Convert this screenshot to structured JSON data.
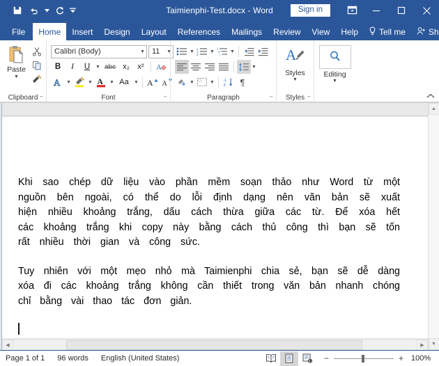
{
  "titlebar": {
    "document_title": "Taimienphi-Test.docx  -  Word",
    "quick_access": [
      {
        "name": "save",
        "label": "Save"
      },
      {
        "name": "undo",
        "label": "Undo"
      },
      {
        "name": "redo",
        "label": "Redo"
      },
      {
        "name": "customize-quick-access-toolbar",
        "label": "Customize Quick Access Toolbar"
      }
    ],
    "sign_in": "Sign in",
    "window_buttons": [
      {
        "name": "ribbon-display-options",
        "label": "Ribbon Display Options"
      },
      {
        "name": "minimize",
        "label": "Minimize"
      },
      {
        "name": "maximize",
        "label": "Maximize"
      },
      {
        "name": "close",
        "label": "Close"
      }
    ]
  },
  "tabs": [
    {
      "label": "File",
      "active": false
    },
    {
      "label": "Home",
      "active": true
    },
    {
      "label": "Insert",
      "active": false
    },
    {
      "label": "Design",
      "active": false
    },
    {
      "label": "Layout",
      "active": false
    },
    {
      "label": "References",
      "active": false
    },
    {
      "label": "Mailings",
      "active": false
    },
    {
      "label": "Review",
      "active": false
    },
    {
      "label": "View",
      "active": false
    },
    {
      "label": "Help",
      "active": false
    }
  ],
  "tab_right": {
    "tell_me": "Tell me",
    "share": "Share"
  },
  "ribbon": {
    "clipboard": {
      "group_label": "Clipboard",
      "paste_label": "Paste",
      "buttons": [
        {
          "name": "cut",
          "label": "Cut"
        },
        {
          "name": "copy",
          "label": "Copy"
        },
        {
          "name": "format-painter",
          "label": "Format Painter"
        }
      ]
    },
    "font": {
      "group_label": "Font",
      "font_name": "Calibri (Body)",
      "font_size": "11",
      "buttons": [
        {
          "name": "bold",
          "label": "B"
        },
        {
          "name": "italic",
          "label": "I"
        },
        {
          "name": "underline",
          "label": "U"
        },
        {
          "name": "strikethrough",
          "label": "abc"
        },
        {
          "name": "subscript",
          "label": "x₂"
        },
        {
          "name": "superscript",
          "label": "x²"
        },
        {
          "name": "clear-formatting",
          "label": "Clear All Formatting"
        },
        {
          "name": "text-effects",
          "label": "Text Effects and Typography"
        },
        {
          "name": "text-highlight-color",
          "label": "Text Highlight Color"
        },
        {
          "name": "font-color",
          "label": "Font Color"
        },
        {
          "name": "change-case",
          "label": "Aa"
        },
        {
          "name": "grow-font",
          "label": "A"
        },
        {
          "name": "shrink-font",
          "label": "A"
        }
      ]
    },
    "paragraph": {
      "group_label": "Paragraph",
      "buttons": [
        {
          "name": "bullets",
          "label": "Bullets"
        },
        {
          "name": "numbering",
          "label": "Numbering"
        },
        {
          "name": "multilevel-list",
          "label": "Multilevel List"
        },
        {
          "name": "decrease-indent",
          "label": "Decrease Indent"
        },
        {
          "name": "increase-indent",
          "label": "Increase Indent"
        },
        {
          "name": "align-left",
          "label": "Align Left"
        },
        {
          "name": "align-center",
          "label": "Center"
        },
        {
          "name": "align-right",
          "label": "Align Right"
        },
        {
          "name": "justify",
          "label": "Justify"
        },
        {
          "name": "line-spacing",
          "label": "Line and Paragraph Spacing"
        },
        {
          "name": "shading",
          "label": "Shading"
        },
        {
          "name": "borders",
          "label": "Borders"
        },
        {
          "name": "sort",
          "label": "Sort"
        },
        {
          "name": "show-formatting-marks",
          "label": "¶"
        }
      ]
    },
    "styles": {
      "group_label": "Styles",
      "button_label": "Styles"
    },
    "editing": {
      "group_label": "Editing",
      "button_label": "Editing"
    },
    "collapse_label": "Collapse the Ribbon"
  },
  "document": {
    "paragraphs": [
      "Khi sao chép dữ liệu vào phần mềm soạn thảo như Word từ một nguồn bên ngoài, có thể do lỗi định dạng nên văn bản sẽ xuất hiện nhiều khoảng trắng, dấu cách thừa giữa các từ. Để xóa hết các khoảng trắng khi copy này bằng cách thủ công thì bạn sẽ tốn rất nhiều thời gian và công sức.",
      "Tuy nhiên với một mẹo nhỏ mà Taimienphi chia sẻ, bạn sẽ dễ dàng xóa đi các khoảng trắng không cần thiết trong văn bản nhanh chóng chỉ bằng vài thao tác đơn giản."
    ]
  },
  "statusbar": {
    "page": "Page 1 of 1",
    "words": "96 words",
    "language": "English (United States)",
    "views": [
      {
        "name": "read-mode",
        "label": "Read Mode",
        "active": false
      },
      {
        "name": "print-layout",
        "label": "Print Layout",
        "active": true
      },
      {
        "name": "web-layout",
        "label": "Web Layout",
        "active": false
      }
    ],
    "zoom_out": "−",
    "zoom_in": "+",
    "zoom_percent": "100%"
  },
  "colors": {
    "brand_blue": "#2b579a",
    "ribbon_bg": "#ffffff",
    "page_bg": "#ffffff",
    "canvas_bg": "#e9e9e9"
  }
}
